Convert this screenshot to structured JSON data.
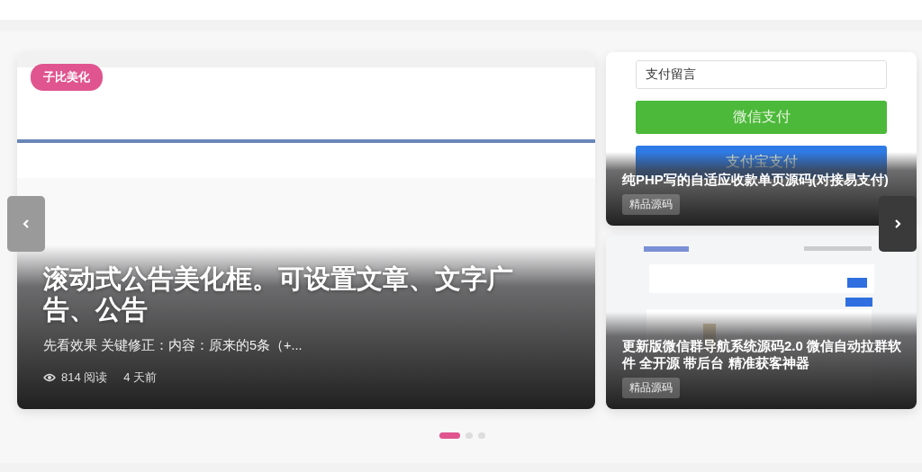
{
  "featured": {
    "tag": "子比美化",
    "title": "滚动式公告美化框。可设置文章、文字广告、公告",
    "excerpt": "先看效果 关键修正：内容：原来的5条（+...",
    "views": "814 阅读",
    "time": "4 天前"
  },
  "side_posts": [
    {
      "kind": "payment",
      "field_value": "支付留言",
      "buttons": [
        {
          "label": "微信支付",
          "color": "#4cb93a"
        },
        {
          "label": "支付宝支付",
          "color": "#2f7be6"
        }
      ],
      "title": "纯PHP写的自适应收款单页源码(对接易支付)",
      "category": "精品源码"
    },
    {
      "kind": "admin",
      "title": "更新版微信群导航系统源码2.0 微信自动拉群软件 全开源 带后台 精准获客神器",
      "category": "精品源码"
    }
  ],
  "pagination": [
    {
      "selected": true
    },
    {
      "selected": false
    },
    {
      "selected": false
    }
  ]
}
